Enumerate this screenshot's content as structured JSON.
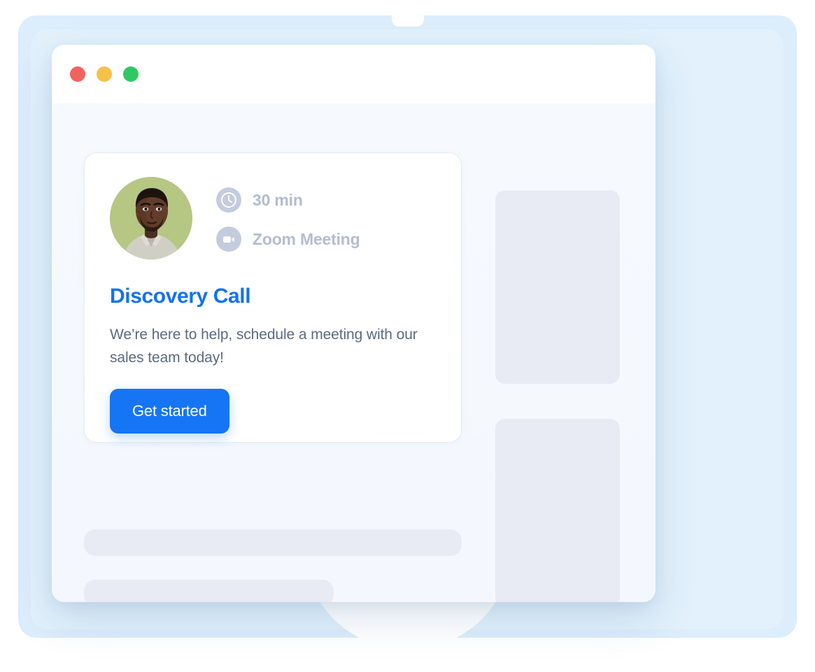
{
  "window": {
    "traffic_lights": [
      {
        "name": "close",
        "color": "#f2635f"
      },
      {
        "name": "minimize",
        "color": "#f6c04a"
      },
      {
        "name": "maximize",
        "color": "#2fc963"
      }
    ]
  },
  "event_card": {
    "avatar": {
      "icon": "avatar-portrait",
      "background_color": "#b6c683"
    },
    "meta": [
      {
        "icon": "clock-icon",
        "label": "30 min"
      },
      {
        "icon": "video-camera-icon",
        "label": "Zoom Meeting"
      }
    ],
    "title": "Discovery Call",
    "description": "We’re here to help, schedule a meeting with our sales team today!",
    "cta_label": "Get started"
  },
  "colors": {
    "accent_blue": "#1575f5",
    "title_blue": "#1273ef",
    "meta_text": "#b3bcd0",
    "body_text": "#5a6b80",
    "skeleton": "#e8ebf3",
    "window_bg": "#f6faff",
    "backdrop": "#dcedfb"
  },
  "placeholders": {
    "right_blocks": [
      {
        "name": "skeleton-block-top"
      },
      {
        "name": "skeleton-block-bottom"
      }
    ],
    "bottom_bars": [
      {
        "name": "skeleton-bar-wide"
      },
      {
        "name": "skeleton-bar-short"
      }
    ]
  }
}
